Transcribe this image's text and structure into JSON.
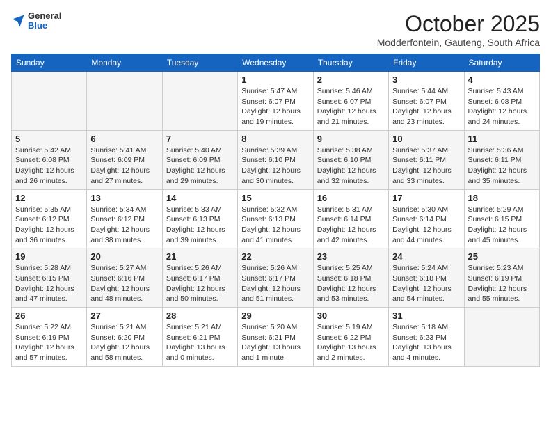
{
  "header": {
    "logo_general": "General",
    "logo_blue": "Blue",
    "month_title": "October 2025",
    "location": "Modderfontein, Gauteng, South Africa"
  },
  "weekdays": [
    "Sunday",
    "Monday",
    "Tuesday",
    "Wednesday",
    "Thursday",
    "Friday",
    "Saturday"
  ],
  "weeks": [
    [
      {
        "day": "",
        "info": ""
      },
      {
        "day": "",
        "info": ""
      },
      {
        "day": "",
        "info": ""
      },
      {
        "day": "1",
        "info": "Sunrise: 5:47 AM\nSunset: 6:07 PM\nDaylight: 12 hours\nand 19 minutes."
      },
      {
        "day": "2",
        "info": "Sunrise: 5:46 AM\nSunset: 6:07 PM\nDaylight: 12 hours\nand 21 minutes."
      },
      {
        "day": "3",
        "info": "Sunrise: 5:44 AM\nSunset: 6:07 PM\nDaylight: 12 hours\nand 23 minutes."
      },
      {
        "day": "4",
        "info": "Sunrise: 5:43 AM\nSunset: 6:08 PM\nDaylight: 12 hours\nand 24 minutes."
      }
    ],
    [
      {
        "day": "5",
        "info": "Sunrise: 5:42 AM\nSunset: 6:08 PM\nDaylight: 12 hours\nand 26 minutes."
      },
      {
        "day": "6",
        "info": "Sunrise: 5:41 AM\nSunset: 6:09 PM\nDaylight: 12 hours\nand 27 minutes."
      },
      {
        "day": "7",
        "info": "Sunrise: 5:40 AM\nSunset: 6:09 PM\nDaylight: 12 hours\nand 29 minutes."
      },
      {
        "day": "8",
        "info": "Sunrise: 5:39 AM\nSunset: 6:10 PM\nDaylight: 12 hours\nand 30 minutes."
      },
      {
        "day": "9",
        "info": "Sunrise: 5:38 AM\nSunset: 6:10 PM\nDaylight: 12 hours\nand 32 minutes."
      },
      {
        "day": "10",
        "info": "Sunrise: 5:37 AM\nSunset: 6:11 PM\nDaylight: 12 hours\nand 33 minutes."
      },
      {
        "day": "11",
        "info": "Sunrise: 5:36 AM\nSunset: 6:11 PM\nDaylight: 12 hours\nand 35 minutes."
      }
    ],
    [
      {
        "day": "12",
        "info": "Sunrise: 5:35 AM\nSunset: 6:12 PM\nDaylight: 12 hours\nand 36 minutes."
      },
      {
        "day": "13",
        "info": "Sunrise: 5:34 AM\nSunset: 6:12 PM\nDaylight: 12 hours\nand 38 minutes."
      },
      {
        "day": "14",
        "info": "Sunrise: 5:33 AM\nSunset: 6:13 PM\nDaylight: 12 hours\nand 39 minutes."
      },
      {
        "day": "15",
        "info": "Sunrise: 5:32 AM\nSunset: 6:13 PM\nDaylight: 12 hours\nand 41 minutes."
      },
      {
        "day": "16",
        "info": "Sunrise: 5:31 AM\nSunset: 6:14 PM\nDaylight: 12 hours\nand 42 minutes."
      },
      {
        "day": "17",
        "info": "Sunrise: 5:30 AM\nSunset: 6:14 PM\nDaylight: 12 hours\nand 44 minutes."
      },
      {
        "day": "18",
        "info": "Sunrise: 5:29 AM\nSunset: 6:15 PM\nDaylight: 12 hours\nand 45 minutes."
      }
    ],
    [
      {
        "day": "19",
        "info": "Sunrise: 5:28 AM\nSunset: 6:15 PM\nDaylight: 12 hours\nand 47 minutes."
      },
      {
        "day": "20",
        "info": "Sunrise: 5:27 AM\nSunset: 6:16 PM\nDaylight: 12 hours\nand 48 minutes."
      },
      {
        "day": "21",
        "info": "Sunrise: 5:26 AM\nSunset: 6:17 PM\nDaylight: 12 hours\nand 50 minutes."
      },
      {
        "day": "22",
        "info": "Sunrise: 5:26 AM\nSunset: 6:17 PM\nDaylight: 12 hours\nand 51 minutes."
      },
      {
        "day": "23",
        "info": "Sunrise: 5:25 AM\nSunset: 6:18 PM\nDaylight: 12 hours\nand 53 minutes."
      },
      {
        "day": "24",
        "info": "Sunrise: 5:24 AM\nSunset: 6:18 PM\nDaylight: 12 hours\nand 54 minutes."
      },
      {
        "day": "25",
        "info": "Sunrise: 5:23 AM\nSunset: 6:19 PM\nDaylight: 12 hours\nand 55 minutes."
      }
    ],
    [
      {
        "day": "26",
        "info": "Sunrise: 5:22 AM\nSunset: 6:19 PM\nDaylight: 12 hours\nand 57 minutes."
      },
      {
        "day": "27",
        "info": "Sunrise: 5:21 AM\nSunset: 6:20 PM\nDaylight: 12 hours\nand 58 minutes."
      },
      {
        "day": "28",
        "info": "Sunrise: 5:21 AM\nSunset: 6:21 PM\nDaylight: 13 hours\nand 0 minutes."
      },
      {
        "day": "29",
        "info": "Sunrise: 5:20 AM\nSunset: 6:21 PM\nDaylight: 13 hours\nand 1 minute."
      },
      {
        "day": "30",
        "info": "Sunrise: 5:19 AM\nSunset: 6:22 PM\nDaylight: 13 hours\nand 2 minutes."
      },
      {
        "day": "31",
        "info": "Sunrise: 5:18 AM\nSunset: 6:23 PM\nDaylight: 13 hours\nand 4 minutes."
      },
      {
        "day": "",
        "info": ""
      }
    ]
  ]
}
